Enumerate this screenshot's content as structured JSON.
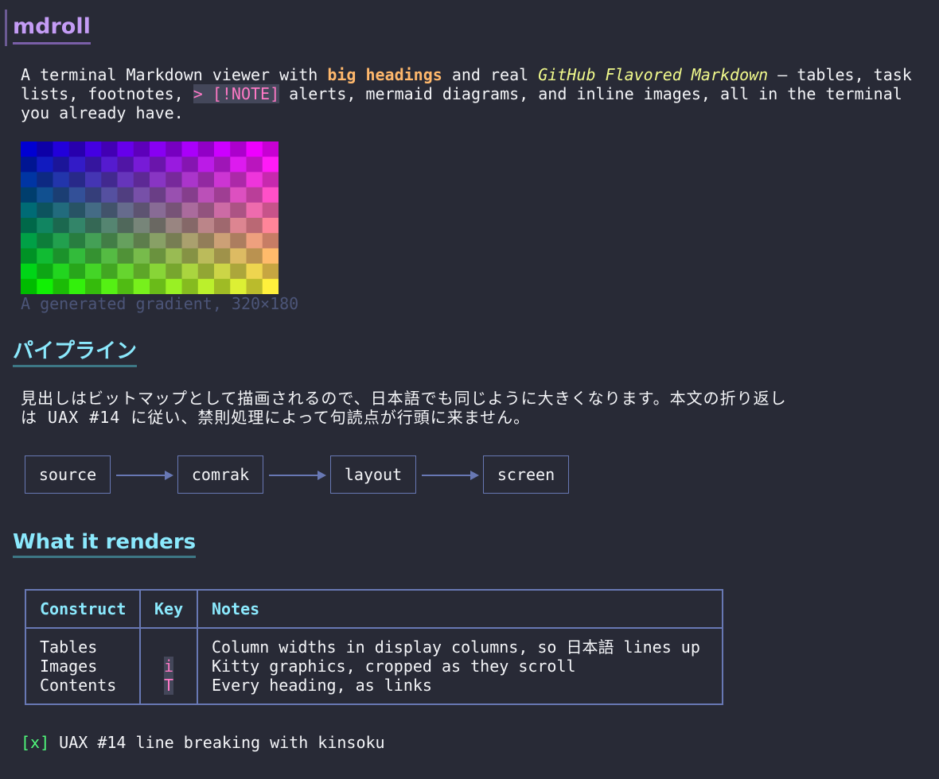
{
  "heading1": "mdroll",
  "intro": {
    "t1": "A terminal Markdown viewer with ",
    "bold": "big headings",
    "t2": " and real ",
    "italic": "GitHub Flavored Markdown",
    "t3": " — tables, task",
    "t4": "lists, footnotes, ",
    "code": "> [!NOTE]",
    "t5": " alerts, mermaid diagrams, and inline images, all in the terminal",
    "t6": "you already have."
  },
  "image_caption": "A generated gradient, 320×180",
  "heading2_pipeline": "パイプライン",
  "pipeline_text": {
    "line1": "見出しはビットマップとして描画されるので、日本語でも同じように大きくなります。本文の折り返し",
    "line2": "は UAX #14 に従い、禁則処理によって句読点が行頭に来ません。"
  },
  "diagram": {
    "nodes": [
      "source",
      "comrak",
      "layout",
      "screen"
    ]
  },
  "heading2_renders": "What it renders",
  "table": {
    "headers": [
      "Construct",
      "Key",
      "Notes"
    ],
    "rows": [
      {
        "construct": "Tables",
        "key": "",
        "notes": "Column widths in display columns, so 日本語 lines up"
      },
      {
        "construct": "Images",
        "key": "i",
        "notes": "Kitty graphics, cropped as they scroll"
      },
      {
        "construct": "Contents",
        "key": "T",
        "notes": "Every heading, as links"
      }
    ]
  },
  "task": {
    "checkbox": "[x]",
    "label": "UAX #14 line breaking with kinsoku"
  },
  "colors": {
    "background": "#282a36",
    "h1": "#c49cf5",
    "h2": "#8be9fd",
    "bold": "#ffb86c",
    "italic": "#f1fa8c",
    "code": "#ff79c6",
    "border": "#6878b4",
    "check": "#50fa7b"
  }
}
